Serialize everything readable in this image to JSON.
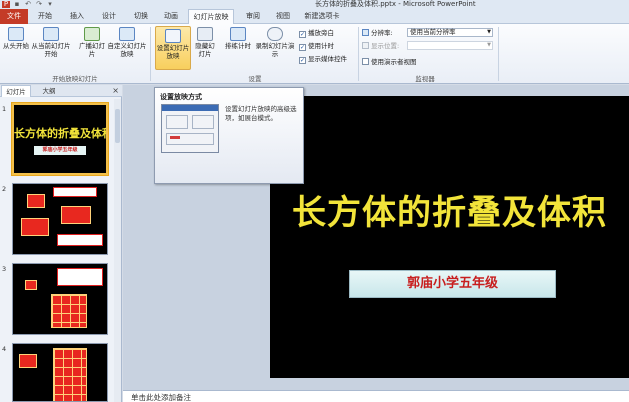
{
  "window": {
    "title": "长方体的折叠及体积.pptx - Microsoft PowerPoint"
  },
  "tabs": {
    "file": "文件",
    "items": [
      "开始",
      "插入",
      "设计",
      "切换",
      "动画",
      "幻灯片放映",
      "审阅",
      "视图",
      "新建选项卡"
    ],
    "active_index": 5
  },
  "ribbon": {
    "start_group": {
      "from_beginning": "从头开始",
      "from_current": "从当前幻灯片开始",
      "broadcast": "广播幻灯片",
      "custom": "自定义幻灯片放映",
      "label": "开始放映幻灯片"
    },
    "setup_group": {
      "setup_show": "设置幻灯片放映",
      "hide_slide": "隐藏幻灯片",
      "rehearse": "排练计时",
      "record": "录制幻灯片演示",
      "check_narration": "播放旁白",
      "check_timings": "使用计时",
      "check_media": "显示媒体控件",
      "label": "设置"
    },
    "monitor_group": {
      "resolution_label": "分辨率:",
      "resolution_value": "使用当前分辨率",
      "show_on_label": "显示位置:",
      "presenter_view": "使用演示者视图",
      "label": "监视器"
    }
  },
  "panel": {
    "tab_slides": "幻灯片",
    "tab_outline": "大纲",
    "close": "×",
    "slide_numbers": [
      "1",
      "2",
      "3",
      "4"
    ],
    "thumb1_title": "长方体的折叠及体积",
    "thumb1_sub": "郭庙小学五年级"
  },
  "slide": {
    "title": "长方体的折叠及体积",
    "subtitle": "郭庙小学五年级"
  },
  "notes": {
    "placeholder": "单击此处添加备注"
  },
  "tooltip": {
    "title": "设置放映方式",
    "body": "设置幻灯片放映的高级选项，如展台模式。"
  },
  "colors": {
    "accent": "#c43b27",
    "slide_title": "#f2e43a",
    "subtitle_text": "#c81e1e"
  }
}
